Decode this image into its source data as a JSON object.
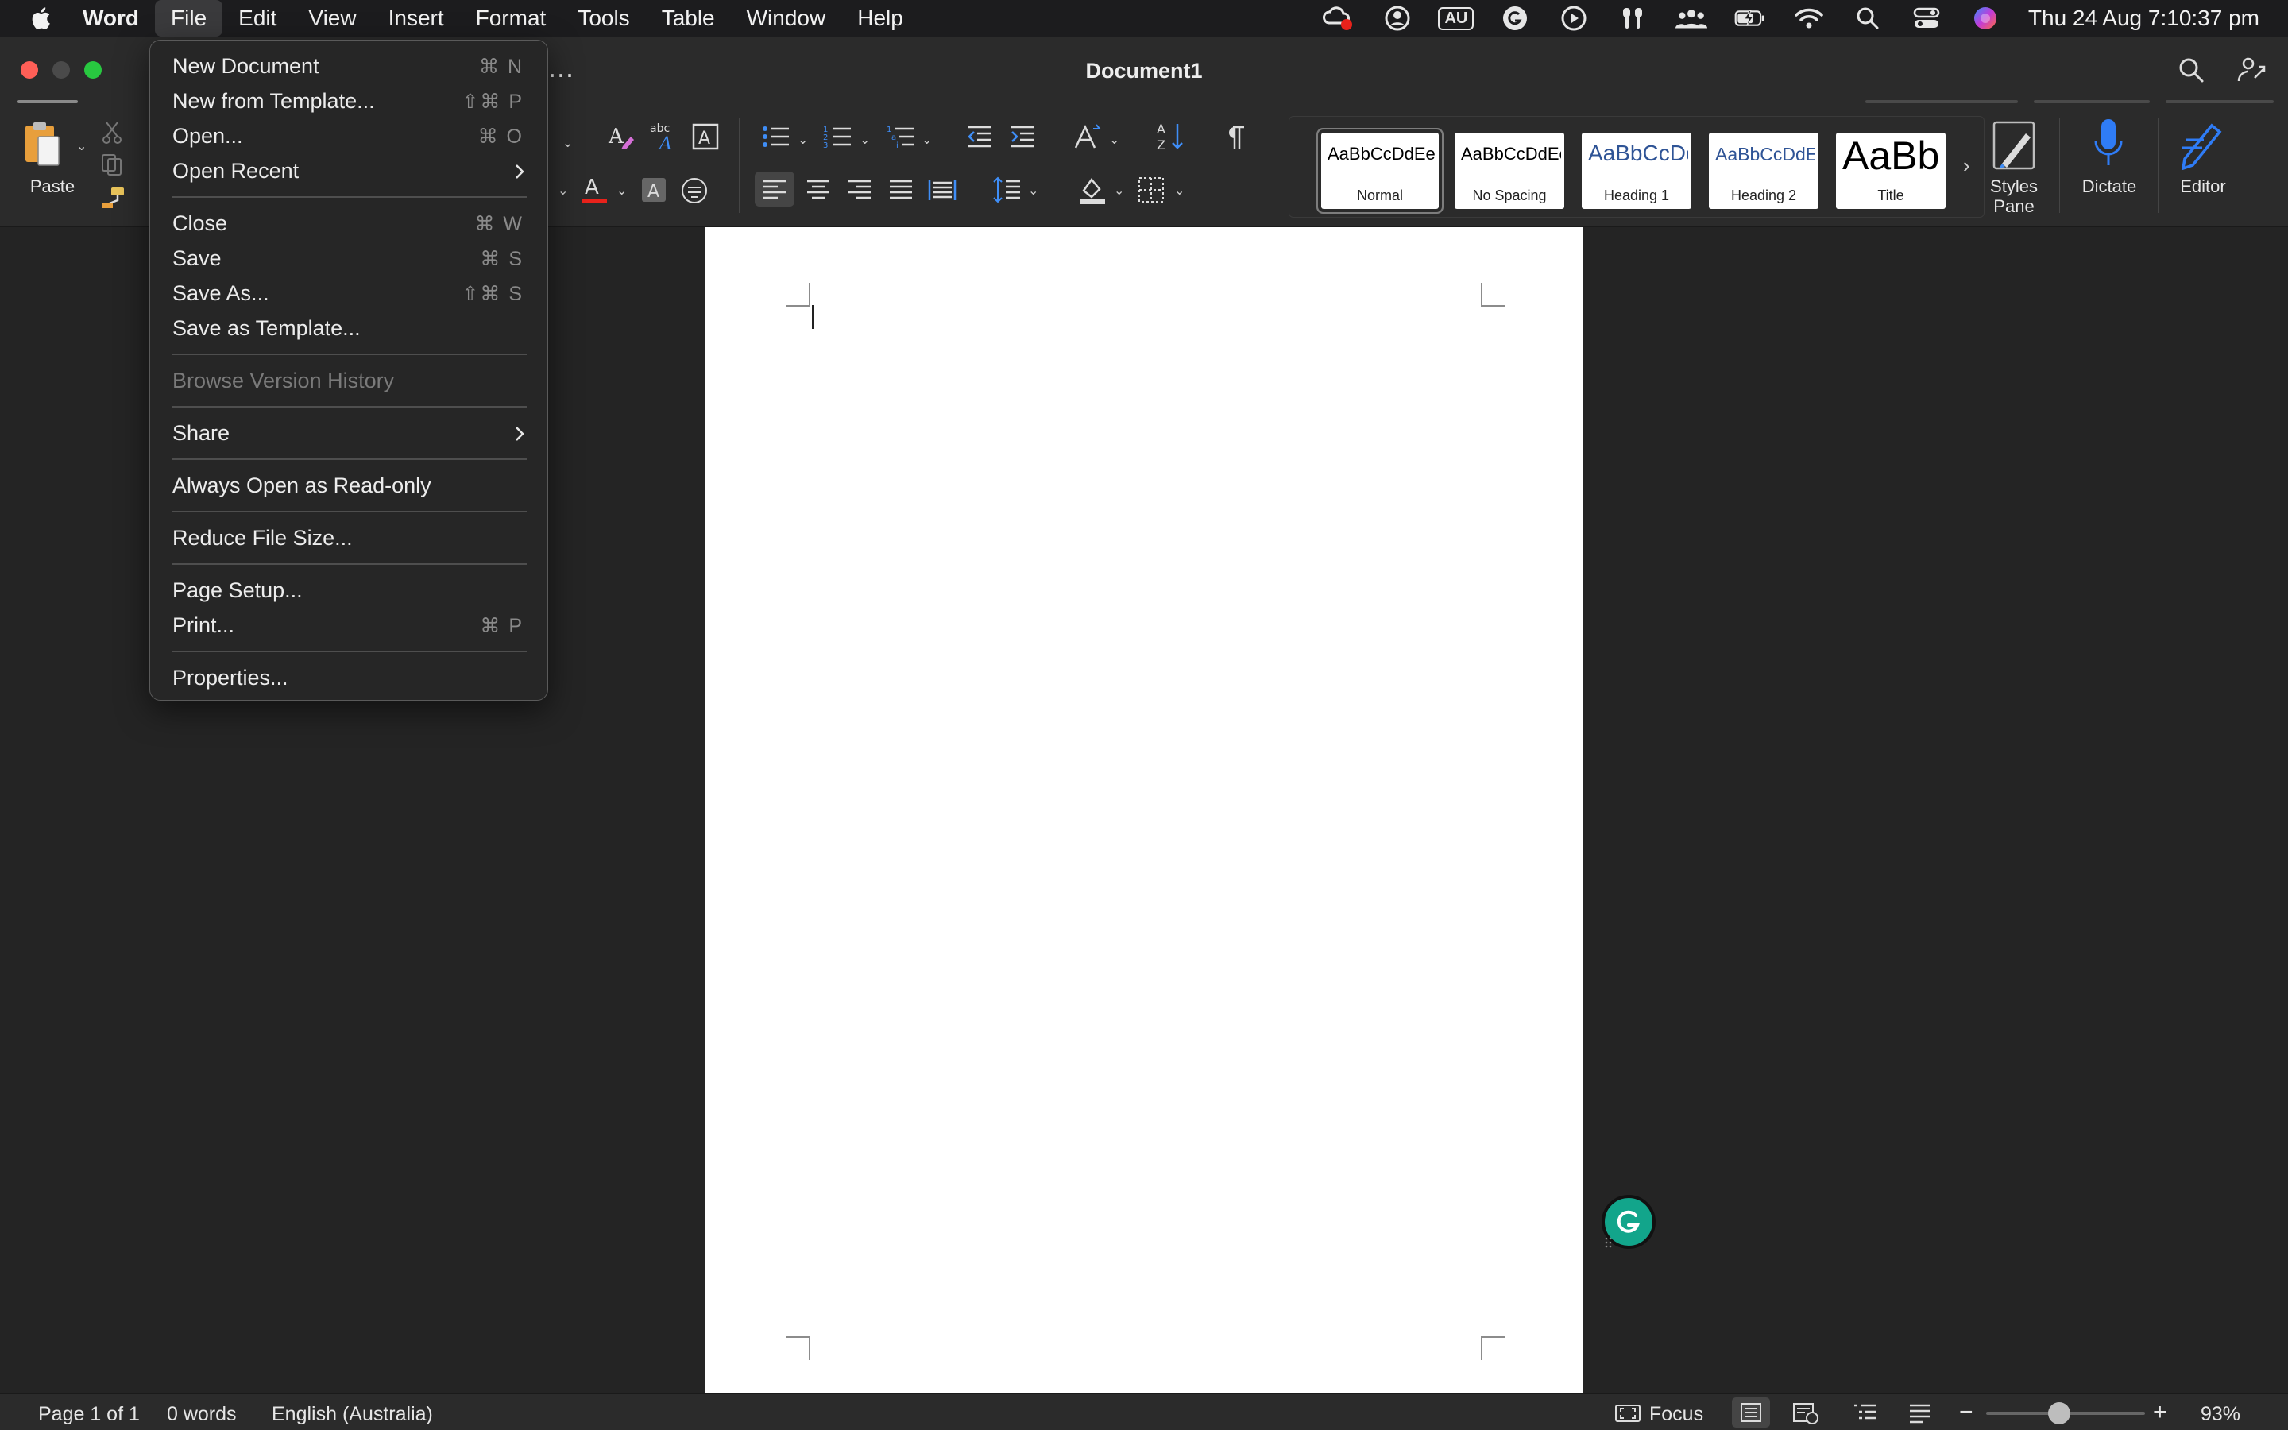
{
  "menubar": {
    "app_name": "Word",
    "menus": [
      "File",
      "Edit",
      "View",
      "Insert",
      "Format",
      "Tools",
      "Table",
      "Window",
      "Help"
    ],
    "input_source": "AU",
    "datetime": "Thu 24 Aug  7:10:37 pm"
  },
  "window": {
    "title": "Document1",
    "more_label": "..."
  },
  "ribbon": {
    "paste_label": "Paste",
    "styles": [
      {
        "name": "Normal",
        "sample": "AaBbCcDdEe"
      },
      {
        "name": "No Spacing",
        "sample": "AaBbCcDdEe"
      },
      {
        "name": "Heading 1",
        "sample": "AaBbCcDc"
      },
      {
        "name": "Heading 2",
        "sample": "AaBbCcDdEe"
      },
      {
        "name": "Title",
        "sample": "AaBb("
      }
    ],
    "styles_pane_label": "Styles Pane",
    "dictate_label": "Dictate",
    "editor_label": "Editor",
    "accent_blue": "#2f7cf6",
    "font_color_red": "#e8221b"
  },
  "file_menu": {
    "items": [
      {
        "label": "New Document",
        "shortcut": "⌘ N"
      },
      {
        "label": "New from Template...",
        "shortcut": "⇧⌘ P"
      },
      {
        "label": "Open...",
        "shortcut": "⌘ O"
      },
      {
        "label": "Open Recent",
        "submenu": true
      },
      {
        "label": "Close",
        "shortcut": "⌘ W"
      },
      {
        "label": "Save",
        "shortcut": "⌘ S"
      },
      {
        "label": "Save As...",
        "shortcut": "⇧⌘ S"
      },
      {
        "label": "Save as Template..."
      },
      {
        "label": "Browse Version History",
        "disabled": true
      },
      {
        "label": "Share",
        "submenu": true
      },
      {
        "label": "Always Open as Read-only"
      },
      {
        "label": "Reduce File Size..."
      },
      {
        "label": "Page Setup..."
      },
      {
        "label": "Print...",
        "shortcut": "⌘ P"
      },
      {
        "label": "Properties..."
      }
    ]
  },
  "statusbar": {
    "page": "Page 1 of 1",
    "words": "0 words",
    "language": "English (Australia)",
    "focus_label": "Focus",
    "zoom_minus": "−",
    "zoom_plus": "+",
    "zoom": "93%",
    "zoom_value": 0.93
  },
  "icons": [
    "apple-icon",
    "paste-icon",
    "cut-icon",
    "copy-icon",
    "format-painter-icon",
    "search-icon",
    "share-icon",
    "grammarly-icon",
    "microphone-icon",
    "editor-pen-icon"
  ]
}
